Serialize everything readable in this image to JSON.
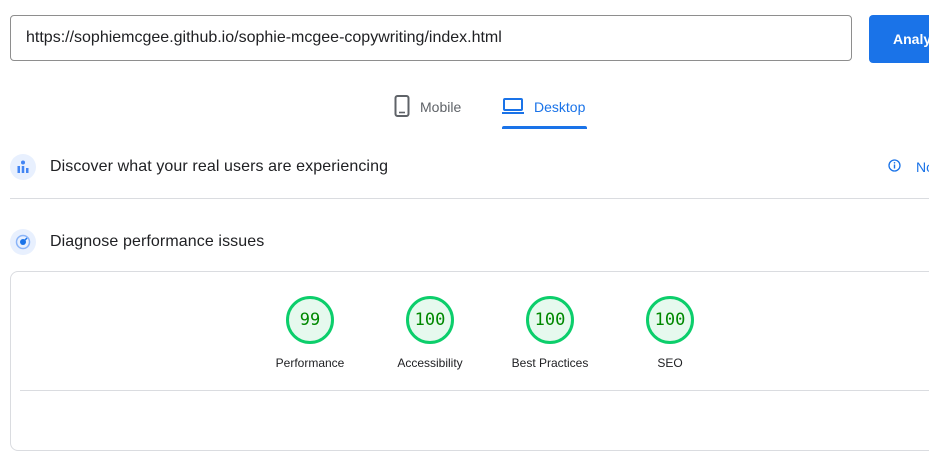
{
  "url_bar": {
    "value": "https://sophiemcgee.github.io/sophie-mcgee-copywriting/index.html",
    "button_label": "Analyze"
  },
  "tabs": [
    {
      "label": "Mobile",
      "icon": "mobile-phone-icon",
      "selected": false
    },
    {
      "label": "Desktop",
      "icon": "laptop-icon",
      "selected": true
    }
  ],
  "discover": {
    "title": "Discover what your real users are experiencing",
    "icon": "users-chart-icon",
    "link_icon": "info-icon",
    "link_text": "No Data"
  },
  "diagnose": {
    "title": "Diagnose performance issues",
    "icon": "speed-gauge-icon"
  },
  "scores": [
    {
      "value": "99",
      "label": "Performance"
    },
    {
      "value": "100",
      "label": "Accessibility"
    },
    {
      "value": "100",
      "label": "Best Practices"
    },
    {
      "value": "100",
      "label": "SEO"
    }
  ],
  "colors": {
    "accent": "#1a73e8",
    "pass_ring": "#0cce6b",
    "pass_text": "#008800",
    "pass_fill": "#e6f9ee"
  }
}
